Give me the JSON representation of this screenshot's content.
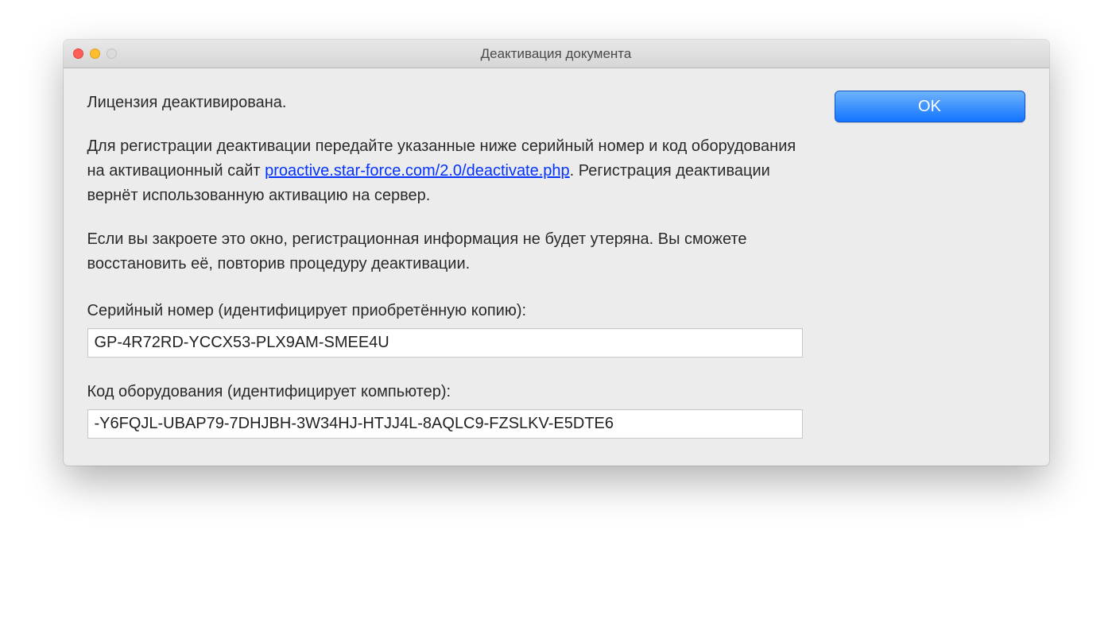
{
  "window": {
    "title": "Деактивация документа"
  },
  "dialog": {
    "status": "Лицензия деактивирована.",
    "instruction_prefix": "Для регистрации деактивации передайте указанные ниже серийный номер и код оборудования на активационный сайт ",
    "link": "proactive.star-force.com/2.0/deactivate.php",
    "instruction_suffix": ". Регистрация деактивации вернёт использованную активацию на сервер.",
    "note": "Если вы закроете это окно, регистрационная информация не будет утеряна. Вы сможете восстановить её, повторив процедуру деактивации.",
    "serial_label": "Серийный номер (идентифицирует приобретённую копию):",
    "serial_value": "GP-4R72RD-YCCX53-PLX9AM-SMEE4U",
    "hw_label": "Код оборудования (идентифицирует компьютер):",
    "hw_value": "-Y6FQJL-UBAP79-7DHJBH-3W34HJ-HTJJ4L-8AQLC9-FZSLKV-E5DTE6"
  },
  "buttons": {
    "ok": "OK"
  }
}
